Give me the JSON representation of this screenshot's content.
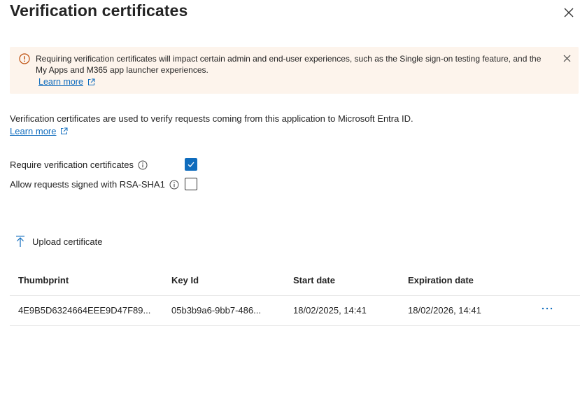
{
  "panel": {
    "title": "Verification certificates",
    "close_icon": "close-icon"
  },
  "banner": {
    "icon": "warning-icon",
    "text": "Requiring verification certificates will impact certain admin and end-user experiences, such as the Single sign-on testing feature, and the My Apps and M365 app launcher experiences.",
    "link_label": "Learn more",
    "link_icon": "external-link-icon",
    "close_icon": "close-icon",
    "background": "#fdf4ec",
    "icon_color": "#bc4b09"
  },
  "description": {
    "text": "Verification certificates are used to verify requests coming from this application to Microsoft Entra ID.",
    "link_label": "Learn more",
    "link_icon": "external-link-icon"
  },
  "options": [
    {
      "label": "Require verification certificates",
      "checked": true,
      "info_icon": "info-icon"
    },
    {
      "label": "Allow requests signed with RSA-SHA1",
      "checked": false,
      "info_icon": "info-icon"
    }
  ],
  "toolbar": {
    "upload_label": "Upload certificate",
    "upload_icon": "upload-icon"
  },
  "table": {
    "headers": [
      "Thumbprint",
      "Key Id",
      "Start date",
      "Expiration date"
    ],
    "rows": [
      [
        "4E9B5D6324664EEE9D47F89...",
        "05b3b9a6-9bb7-486...",
        "18/02/2025, 14:41",
        "18/02/2026, 14:41"
      ]
    ],
    "row_action_icon": "more-icon"
  },
  "colors": {
    "accent": "#0f6cbd",
    "text": "#242424"
  }
}
